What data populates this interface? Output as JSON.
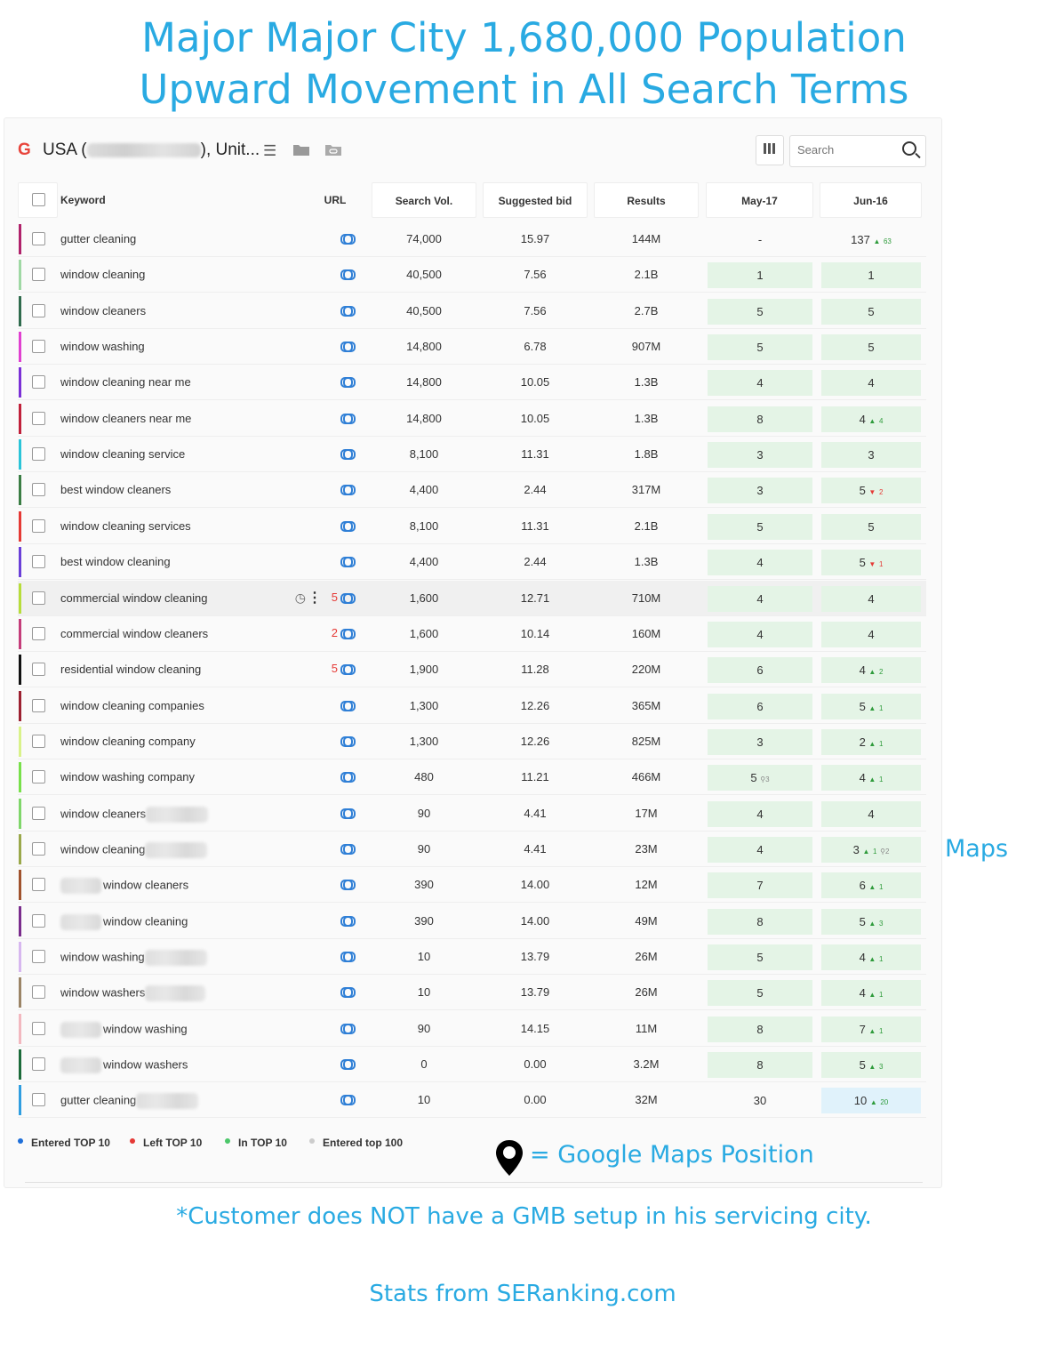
{
  "headline": {
    "line1": "Major Major City 1,680,000 Population",
    "line2": "Upward Movement in All Search Terms"
  },
  "toolbar": {
    "engine_letter": "G",
    "project_prefix": "USA (",
    "project_suffix": "), Unit...",
    "search_placeholder": "Search",
    "icons": [
      "list-icon",
      "folder-icon",
      "link-folder-icon",
      "columns-icon",
      "search-icon"
    ]
  },
  "columns": {
    "keyword": "Keyword",
    "url": "URL",
    "search_vol": "Search Vol.",
    "suggested_bid": "Suggested bid",
    "results": "Results",
    "may": "May-17",
    "jun": "Jun-16"
  },
  "rows": [
    {
      "keyword": "gutter cleaning",
      "vol": "74,000",
      "bid": "15.97",
      "results": "144M",
      "may": "-",
      "jun": "137",
      "jun_change": "63",
      "jun_dir": "up",
      "may_style": "plain",
      "jun_style": "plain",
      "color": "#b0226b"
    },
    {
      "keyword": "window cleaning",
      "vol": "40,500",
      "bid": "7.56",
      "results": "2.1B",
      "may": "1",
      "jun": "1",
      "color": "#9fd8a4"
    },
    {
      "keyword": "window cleaners",
      "vol": "40,500",
      "bid": "7.56",
      "results": "2.7B",
      "may": "5",
      "jun": "5",
      "color": "#2f6b4d"
    },
    {
      "keyword": "window washing",
      "vol": "14,800",
      "bid": "6.78",
      "results": "907M",
      "may": "5",
      "jun": "5",
      "color": "#e040d0"
    },
    {
      "keyword": "window cleaning near me",
      "vol": "14,800",
      "bid": "10.05",
      "results": "1.3B",
      "may": "4",
      "jun": "4",
      "color": "#7b2fd6"
    },
    {
      "keyword": "window cleaners near me",
      "vol": "14,800",
      "bid": "10.05",
      "results": "1.3B",
      "may": "8",
      "jun": "4",
      "jun_change": "4",
      "jun_dir": "up",
      "color": "#c0203a"
    },
    {
      "keyword": "window cleaning service",
      "vol": "8,100",
      "bid": "11.31",
      "results": "1.8B",
      "may": "3",
      "jun": "3",
      "color": "#2bc4d8"
    },
    {
      "keyword": "best window cleaners",
      "vol": "4,400",
      "bid": "2.44",
      "results": "317M",
      "may": "3",
      "jun": "5",
      "jun_change": "2",
      "jun_dir": "down",
      "color": "#3a7d44"
    },
    {
      "keyword": "window cleaning services",
      "vol": "8,100",
      "bid": "11.31",
      "results": "2.1B",
      "may": "5",
      "jun": "5",
      "color": "#e53935"
    },
    {
      "keyword": "best window cleaning",
      "vol": "4,400",
      "bid": "2.44",
      "results": "1.3B",
      "may": "4",
      "jun": "5",
      "jun_change": "1",
      "jun_dir": "down",
      "color": "#6a3fd8"
    },
    {
      "keyword": "commercial window cleaning",
      "vol": "1,600",
      "bid": "12.71",
      "results": "710M",
      "may": "4",
      "jun": "4",
      "url_count": "5",
      "hovered": true,
      "color": "#b7dd3a"
    },
    {
      "keyword": "commercial window cleaners",
      "vol": "1,600",
      "bid": "10.14",
      "results": "160M",
      "may": "4",
      "jun": "4",
      "url_count": "2",
      "color": "#c43d7a"
    },
    {
      "keyword": "residential window cleaning",
      "vol": "1,900",
      "bid": "11.28",
      "results": "220M",
      "may": "6",
      "jun": "4",
      "jun_change": "2",
      "jun_dir": "up",
      "url_count": "5",
      "color": "#111111"
    },
    {
      "keyword": "window cleaning companies",
      "vol": "1,300",
      "bid": "12.26",
      "results": "365M",
      "may": "6",
      "jun": "5",
      "jun_change": "1",
      "jun_dir": "up",
      "color": "#9c2030"
    },
    {
      "keyword": "window cleaning company",
      "vol": "1,300",
      "bid": "12.26",
      "results": "825M",
      "may": "3",
      "jun": "2",
      "jun_change": "1",
      "jun_dir": "up",
      "color": "#d9f28a"
    },
    {
      "keyword": "window washing company",
      "vol": "480",
      "bid": "11.21",
      "results": "466M",
      "may": "5",
      "may_maps": "3",
      "jun": "4",
      "jun_change": "1",
      "jun_dir": "up",
      "color": "#78e04a"
    },
    {
      "keyword": "window cleaners",
      "blur_suffix": 70,
      "vol": "90",
      "bid": "4.41",
      "results": "17M",
      "may": "4",
      "jun": "4",
      "color": "#7fd66a"
    },
    {
      "keyword": "window cleaning",
      "blur_suffix": 70,
      "vol": "90",
      "bid": "4.41",
      "results": "23M",
      "may": "4",
      "jun": "3",
      "jun_change": "1",
      "jun_dir": "up",
      "jun_maps": "2",
      "color": "#9aa84a"
    },
    {
      "keyword": "window cleaners",
      "blur_prefix": true,
      "vol": "390",
      "bid": "14.00",
      "results": "12M",
      "may": "7",
      "jun": "6",
      "jun_change": "1",
      "jun_dir": "up",
      "color": "#a0522d"
    },
    {
      "keyword": "window cleaning",
      "blur_prefix": true,
      "vol": "390",
      "bid": "14.00",
      "results": "49M",
      "may": "8",
      "jun": "5",
      "jun_change": "3",
      "jun_dir": "up",
      "color": "#7a2c8c"
    },
    {
      "keyword": "window washing",
      "blur_suffix": 70,
      "vol": "10",
      "bid": "13.79",
      "results": "26M",
      "may": "5",
      "jun": "4",
      "jun_change": "1",
      "jun_dir": "up",
      "color": "#d7b7ef"
    },
    {
      "keyword": "window washers",
      "blur_suffix": 68,
      "vol": "10",
      "bid": "13.79",
      "results": "26M",
      "may": "5",
      "jun": "4",
      "jun_change": "1",
      "jun_dir": "up",
      "color": "#9b8466"
    },
    {
      "keyword": "window washing",
      "blur_prefix": true,
      "vol": "90",
      "bid": "14.15",
      "results": "11M",
      "may": "8",
      "jun": "7",
      "jun_change": "1",
      "jun_dir": "up",
      "color": "#f2b8bf"
    },
    {
      "keyword": "window washers",
      "blur_prefix": true,
      "vol": "0",
      "bid": "0.00",
      "results": "3.2M",
      "may": "8",
      "jun": "5",
      "jun_change": "3",
      "jun_dir": "up",
      "color": "#1c6b3a"
    },
    {
      "keyword": "gutter cleaning",
      "blur_suffix": 70,
      "vol": "10",
      "bid": "0.00",
      "results": "32M",
      "may": "30",
      "jun": "10",
      "jun_change": "20",
      "jun_dir": "up",
      "may_style": "plain",
      "jun_style": "blue",
      "color": "#2f9ee0"
    }
  ],
  "legend": [
    {
      "label": "Entered TOP 10",
      "color": "#1e6fd9"
    },
    {
      "label": "Left TOP 10",
      "color": "#e53935"
    },
    {
      "label": "In TOP 10",
      "color": "#4cc76a"
    },
    {
      "label": "Entered top 100",
      "color": "#cccccc"
    }
  ],
  "annotations": {
    "maps_side": "Maps",
    "maps_legend": "= Google Maps Position",
    "note": "*Customer does NOT have a GMB setup in his servicing city.",
    "stats": "Stats from SERanking.com"
  }
}
